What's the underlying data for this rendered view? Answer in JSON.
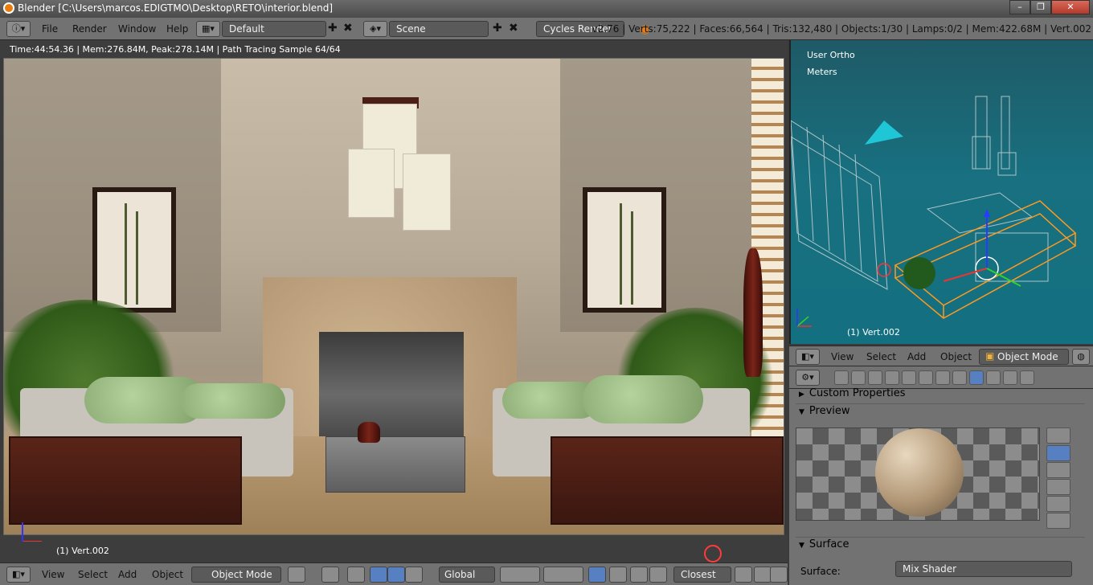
{
  "window": {
    "title": "Blender [C:\\Users\\marcos.EDIGTMO\\Desktop\\RETO\\interior.blend]",
    "minimize": "–",
    "maximize": "❐",
    "close": "✕"
  },
  "topbar": {
    "menus": [
      "File",
      "Render",
      "Window",
      "Help"
    ],
    "screen_layout": "Default",
    "scene": "Scene",
    "engine": "Cycles Render",
    "stats": "v2.76 | Verts:75,222 | Faces:66,564 | Tris:132,480 | Objects:1/30 | Lamps:0/2 | Mem:422.68M | Vert.002"
  },
  "render_view": {
    "status": "Time:44:54.36 | Mem:276.84M, Peak:278.14M | Path Tracing Sample 64/64",
    "object_label": "(1) Vert.002"
  },
  "viewport3d": {
    "view_name": "User Ortho",
    "units": "Meters",
    "object_label": "(1) Vert.002",
    "menus": [
      "View",
      "Select",
      "Add",
      "Object"
    ],
    "mode": "Object Mode"
  },
  "properties": {
    "custom_properties": "Custom Properties",
    "preview": "Preview",
    "surface_panel": "Surface",
    "surface_label": "Surface:",
    "surface_value": "Mix Shader"
  },
  "bottombar": {
    "menus": [
      "View",
      "Select",
      "Add",
      "Object"
    ],
    "mode": "Object Mode",
    "orientation": "Global",
    "snap": "Closest"
  },
  "colors": {
    "header_bg": "#727272",
    "viewport_bg": "#187080",
    "selection": "#ff9a1f",
    "active_tab": "#5680c2"
  }
}
